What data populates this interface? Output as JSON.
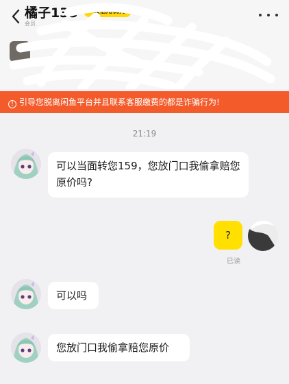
{
  "header": {
    "nickname": "橘子133",
    "credit_badge": "极信用优秀",
    "sub_status": "会员",
    "back_icon": "chevron-left-icon",
    "more_icon": "more-horizontal-icon"
  },
  "fraud_banner": {
    "text": "引导您脱离闲鱼平台并且联系客服缴费的都是诈骗行为!"
  },
  "chat": {
    "time": "21:19",
    "messages": [
      {
        "sender": "other",
        "text": "可以当面转您159，您放门口我偷拿赔您原价吗?"
      },
      {
        "sender": "me",
        "text": "?",
        "status": "已读"
      },
      {
        "sender": "other",
        "text": "可以吗"
      },
      {
        "sender": "other",
        "text": "您放门口我偷拿赔您原价"
      }
    ]
  },
  "colors": {
    "banner": "#f35b2b",
    "my_bubble": "#ffe000",
    "badge": "#ffd60a"
  }
}
